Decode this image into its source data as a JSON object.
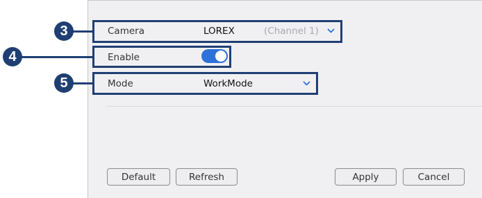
{
  "form": {
    "camera": {
      "label": "Camera",
      "value": "LOREX",
      "channel": "(Channel 1)"
    },
    "enable": {
      "label": "Enable",
      "on": true
    },
    "mode": {
      "label": "Mode",
      "value": "WorkMode"
    }
  },
  "buttons": {
    "default": "Default",
    "refresh": "Refresh",
    "apply": "Apply",
    "cancel": "Cancel"
  },
  "callouts": {
    "camera": "3",
    "enable": "4",
    "mode": "5"
  },
  "colors": {
    "callout": "#1f3f73",
    "toggle_on": "#2d72d9",
    "panel_bg": "#f0f0f2"
  },
  "icons": {
    "camera_dropdown": "chevron-down-icon",
    "mode_dropdown": "chevron-down-icon"
  }
}
